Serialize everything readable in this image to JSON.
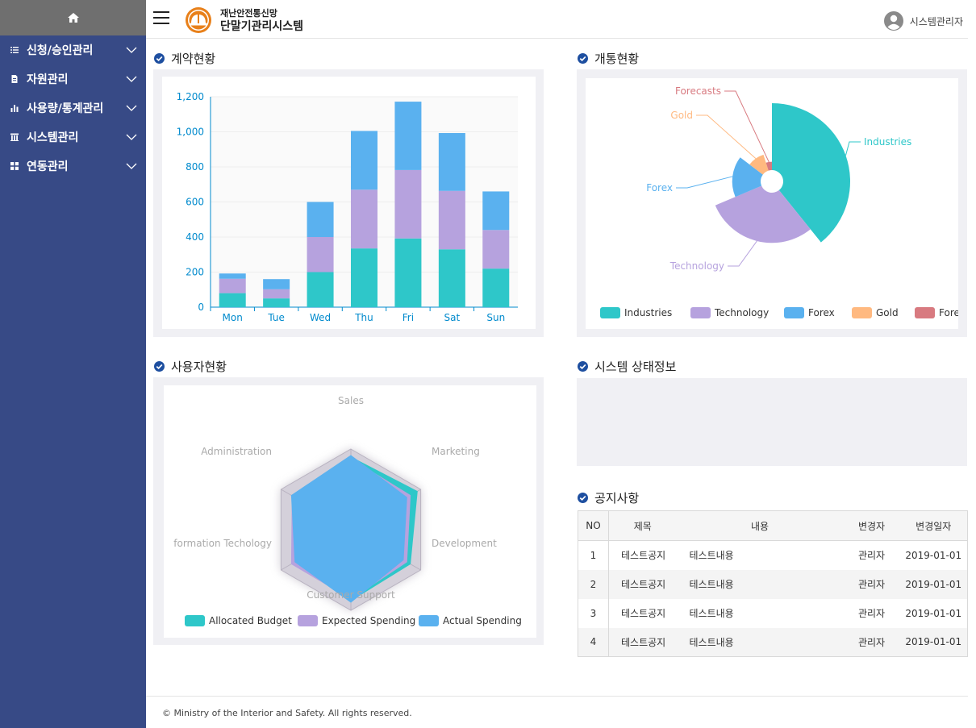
{
  "sidebar": {
    "home_icon": "home-icon",
    "items": [
      {
        "label": "신청/승인관리",
        "icon": "list-icon"
      },
      {
        "label": "자원관리",
        "icon": "document-icon"
      },
      {
        "label": "사용량/통계관리",
        "icon": "bar-chart-icon"
      },
      {
        "label": "시스템관리",
        "icon": "building-icon"
      },
      {
        "label": "연동관리",
        "icon": "grid-icon"
      }
    ]
  },
  "header": {
    "brand_sub": "재난안전통신망",
    "brand_main": "단말기관리시스템",
    "user_name": "시스템관리자"
  },
  "sections": {
    "contract": "계약현황",
    "activation": "개통현황",
    "users": "사용자현황",
    "system_status": "시스템 상태정보",
    "notices": "공지사항"
  },
  "colors": {
    "sidebar": "#374a86",
    "teal": "#2ec7c9",
    "purple": "#b6a2de",
    "blue": "#5ab1ef",
    "orange": "#ffb980",
    "red": "#d87a80",
    "axis_text": "#008acd",
    "check": "#1e4fa0"
  },
  "chart_data": [
    {
      "type": "bar",
      "stacked": true,
      "categories": [
        "Mon",
        "Tue",
        "Wed",
        "Thu",
        "Fri",
        "Sat",
        "Sun"
      ],
      "series": [
        {
          "values": [
            80,
            50,
            200,
            335,
            392,
            330,
            220
          ],
          "color": "#2ec7c9"
        },
        {
          "values": [
            82,
            52,
            200,
            335,
            390,
            333,
            220
          ],
          "color": "#b6a2de"
        },
        {
          "values": [
            30,
            58,
            200,
            335,
            390,
            330,
            220
          ],
          "color": "#5ab1ef"
        }
      ],
      "ylim": [
        0,
        1200
      ],
      "yticks": [
        "0",
        "200",
        "400",
        "600",
        "800",
        "1,000",
        "1,200"
      ],
      "grid": true
    },
    {
      "type": "pie",
      "rose": true,
      "categories": [
        "Industries",
        "Technology",
        "Forex",
        "Gold",
        "Forecasts"
      ],
      "values": [
        40,
        30,
        17,
        10,
        5
      ],
      "colors": [
        "#2ec7c9",
        "#b6a2de",
        "#5ab1ef",
        "#ffb980",
        "#d87a80"
      ],
      "legend": "bottom"
    },
    {
      "type": "radar",
      "indicators": [
        "Sales",
        "Marketing",
        "Development",
        "Customer Support",
        "formation Techology",
        "Administration"
      ],
      "series": [
        {
          "name": "Allocated Budget",
          "values": [
            0.9,
            0.95,
            0.85,
            0.88,
            0.75,
            0.8
          ],
          "color": "#2ec7c9"
        },
        {
          "name": "Expected Spending",
          "values": [
            0.88,
            0.85,
            0.8,
            0.86,
            0.85,
            0.84
          ],
          "color": "#b6a2de"
        },
        {
          "name": "Actual Spending",
          "values": [
            0.92,
            0.8,
            0.75,
            0.9,
            0.8,
            0.85
          ],
          "color": "#5ab1ef"
        }
      ],
      "legend": "bottom"
    }
  ],
  "notices": {
    "headers": [
      "NO",
      "제목",
      "내용",
      "변경자",
      "변경일자"
    ],
    "rows": [
      {
        "no": "1",
        "title": "테스트공지",
        "content": "테스트내용",
        "author": "관리자",
        "date": "2019-01-01"
      },
      {
        "no": "2",
        "title": "테스트공지",
        "content": "테스트내용",
        "author": "관리자",
        "date": "2019-01-01"
      },
      {
        "no": "3",
        "title": "테스트공지",
        "content": "테스트내용",
        "author": "관리자",
        "date": "2019-01-01"
      },
      {
        "no": "4",
        "title": "테스트공지",
        "content": "테스트내용",
        "author": "관리자",
        "date": "2019-01-01"
      }
    ]
  },
  "footer": {
    "text": "© Ministry of the Interior and Safety. All rights reserved."
  }
}
